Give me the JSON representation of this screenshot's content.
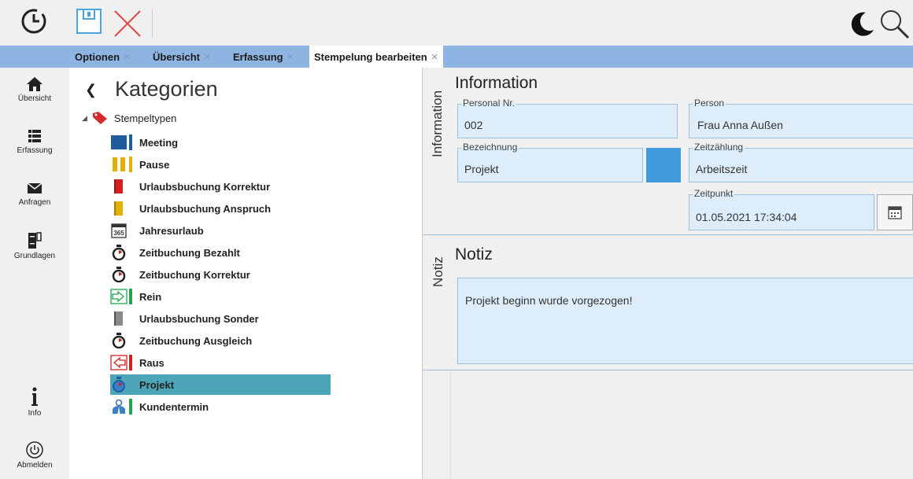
{
  "tabs": [
    "Optionen",
    "Übersicht",
    "Erfassung",
    "Stempelung bearbeiten"
  ],
  "nav": {
    "items": [
      "Übersicht",
      "Erfassung",
      "Anfragen",
      "Grundlagen"
    ],
    "info": "Info",
    "logout": "Abmelden"
  },
  "categories": {
    "title": "Kategorien",
    "root": "Stempeltypen",
    "items": [
      {
        "label": "Meeting",
        "bar": "#1f5c9e",
        "icon": "square-blue-icon"
      },
      {
        "label": "Pause",
        "bar": "#e4b000",
        "icon": "pause-icon"
      },
      {
        "label": "Urlaubsbuchung Korrektur",
        "bar": "",
        "icon": "book-red-icon"
      },
      {
        "label": "Urlaubsbuchung Anspruch",
        "bar": "",
        "icon": "book-yellow-icon"
      },
      {
        "label": "Jahresurlaub",
        "bar": "",
        "icon": "calendar-365-icon"
      },
      {
        "label": "Zeitbuchung Bezahlt",
        "bar": "",
        "icon": "stopwatch-icon"
      },
      {
        "label": "Zeitbuchung Korrektur",
        "bar": "",
        "icon": "stopwatch-icon"
      },
      {
        "label": "Rein",
        "bar": "#1ba84a",
        "icon": "arrow-in-icon"
      },
      {
        "label": "Urlaubsbuchung Sonder",
        "bar": "",
        "icon": "book-gray-icon"
      },
      {
        "label": "Zeitbuchung Ausgleich",
        "bar": "",
        "icon": "stopwatch-icon"
      },
      {
        "label": "Raus",
        "bar": "#d22020",
        "icon": "arrow-out-icon"
      },
      {
        "label": "Projekt",
        "bar": "",
        "icon": "stopwatch-blue-icon"
      },
      {
        "label": "Kundentermin",
        "bar": "#1ba84a",
        "icon": "person-icon"
      }
    ],
    "selected": "Projekt"
  },
  "information": {
    "side_label": "Information",
    "title": "Information",
    "personal_nr_label": "Personal Nr.",
    "personal_nr": "002",
    "person_label": "Person",
    "person": "Frau Anna Außen",
    "bezeichnung_label": "Bezeichnung",
    "bezeichnung": "Projekt",
    "zeitzaehlung_label": "Zeitzählung",
    "zeitzaehlung": "Arbeitszeit",
    "zeitpunkt_label": "Zeitpunkt",
    "zeitpunkt": "01.05.2021 17:34:04",
    "color_swatch": "#3f9bdc"
  },
  "notiz": {
    "side_label": "Notiz",
    "title": "Notiz",
    "text": "Projekt beginn wurde vorgezogen!"
  }
}
